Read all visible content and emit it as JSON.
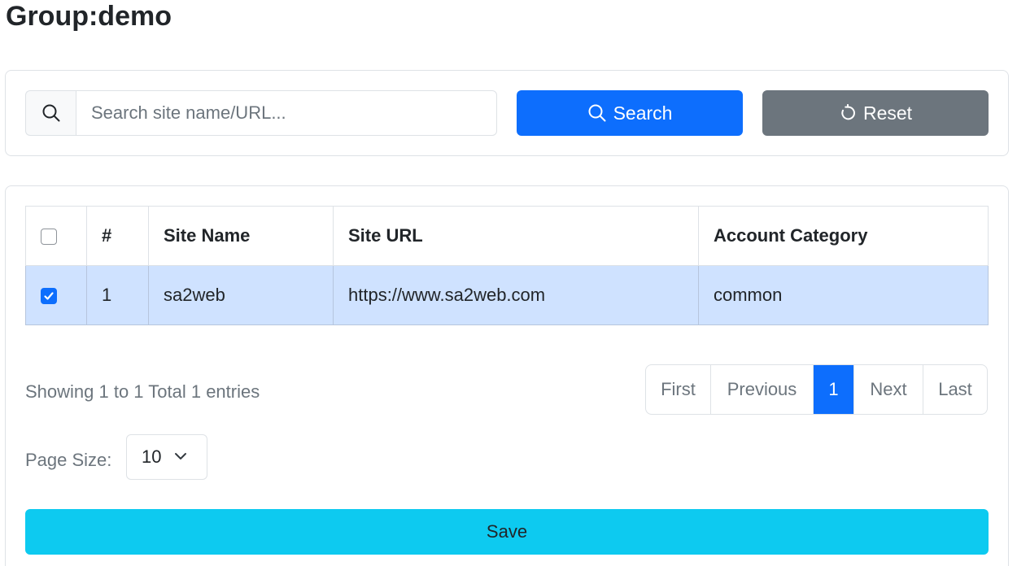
{
  "page": {
    "title": "Group:demo"
  },
  "search": {
    "placeholder": "Search site name/URL...",
    "value": "",
    "search_label": "Search",
    "reset_label": "Reset"
  },
  "table": {
    "headers": [
      "",
      "#",
      "Site Name",
      "Site URL",
      "Account Category"
    ],
    "rows": [
      {
        "checked": true,
        "num": "1",
        "name": "sa2web",
        "url": "https://www.sa2web.com",
        "category": "common"
      }
    ]
  },
  "footer": {
    "showing": "Showing 1 to 1 Total 1 entries",
    "page_size_label": "Page Size:",
    "page_size_value": "10",
    "save_label": "Save"
  },
  "pagination": {
    "first": "First",
    "previous": "Previous",
    "current": "1",
    "next": "Next",
    "last": "Last"
  },
  "colors": {
    "primary": "#0d6efd",
    "secondary": "#6c757d",
    "info": "#0dcaf0",
    "selected_row": "#cfe2ff"
  },
  "icons": {
    "search_addon": "search-icon",
    "search_button": "search-icon",
    "reset_button": "rotate-icon",
    "select_caret": "chevron-down-icon"
  }
}
